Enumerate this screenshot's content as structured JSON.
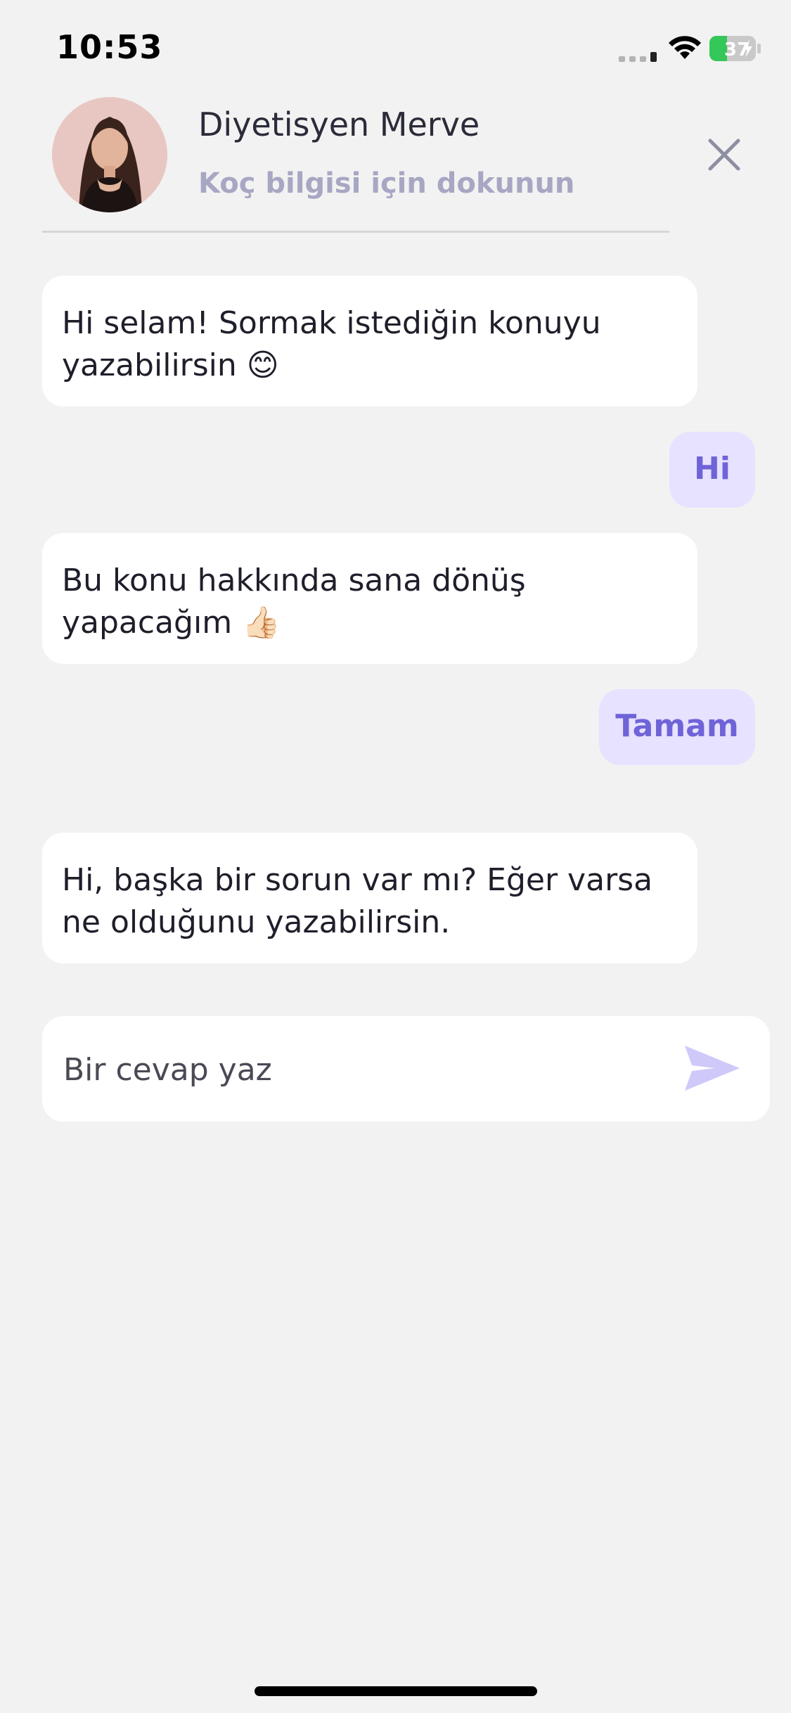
{
  "status_bar": {
    "time": "10:53",
    "battery_level": "37",
    "battery_color": "#34c759"
  },
  "header": {
    "coach_name": "Diyetisyen Merve",
    "subtitle": "Koç bilgisi için dokunun",
    "avatar_icon": "coach-avatar",
    "close_icon": "close-icon"
  },
  "messages": [
    {
      "from": "coach",
      "text": "Hi selam! Sormak istediğin konuyu yazabilirsin 😊"
    },
    {
      "from": "user",
      "text": "Hi"
    },
    {
      "from": "coach",
      "text": "Bu konu hakkında sana dönüş yapacağım 👍🏻"
    },
    {
      "from": "user",
      "text": "Tamam"
    },
    {
      "from": "coach",
      "text": "Hi, başka bir sorun var mı?  Eğer varsa ne olduğunu yazabilirsin."
    }
  ],
  "reply": {
    "placeholder": "Bir cevap yaz",
    "value": "",
    "send_icon": "send-icon"
  },
  "colors": {
    "background": "#f2f2f2",
    "incoming_bubble": "#ffffff",
    "outgoing_bubble": "#e6e2ff",
    "outgoing_text": "#6f63d8",
    "subtitle": "#a7a7c4",
    "send_icon": "#cfc9fa"
  }
}
